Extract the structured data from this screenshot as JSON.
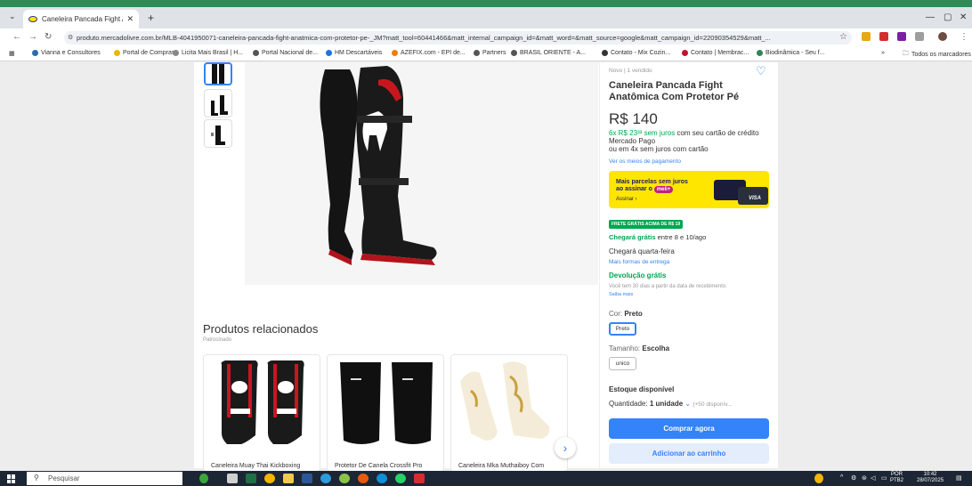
{
  "browser": {
    "tab_title": "Caneleira Pancada Fight Anatô",
    "tab_close": "✕",
    "new_tab": "+",
    "url": "produto.mercadolivre.com.br/MLB-4041950071-caneleira-pancada-fight-anatmica-com-protetor-pe-_JM?matt_tool=60441466&matt_internal_campaign_id=&matt_word=&matt_source=google&matt_campaign_id=22090354529&matt_...",
    "bookmarks": [
      {
        "label": "Vianna e Consultores",
        "color": "#2b6cb0"
      },
      {
        "label": "Portal de Compras",
        "color": "#f0b400"
      },
      {
        "label": "Licita Mais Brasil | H...",
        "color": "#888888"
      },
      {
        "label": "Portal Nacional de...",
        "color": "#555555"
      },
      {
        "label": "HM Descartáveis",
        "color": "#1a73e8"
      },
      {
        "label": "AZEFIX.com - EPI de...",
        "color": "#f07c00"
      },
      {
        "label": "Partners",
        "color": "#555555"
      },
      {
        "label": "BRASIL ORIENTE - A...",
        "color": "#555555"
      },
      {
        "label": "Contato - Mix Cozin...",
        "color": "#333333"
      },
      {
        "label": "Contato | Membrac...",
        "color": "#c8102e"
      },
      {
        "label": "Biodinâmica - Seu f...",
        "color": "#2f855a"
      }
    ],
    "bookmarks_more": "»",
    "all_bookmarks": "Todos os marcadores"
  },
  "product": {
    "condition": "Novo | 1 vendido",
    "title": "Caneleira Pancada Fight Anatômica Com Protetor Pé",
    "price": "R$ 140",
    "installments_green": "6x R$ 23³³ sem juros",
    "installments_rest": " com seu cartão de crédito Mercado Pago",
    "installments_alt": "ou em 4x sem juros com cartão",
    "payment_link": "Ver os meios de pagamento",
    "meli_line1": "Mais parcelas sem juros",
    "meli_line2": "ao assinar o",
    "meli_badge": "meli+",
    "meli_cta": "Assinar ›",
    "visa": "VISA",
    "free_shipping_badge": "FRETE GRÁTIS ACIMA DE R$ 19",
    "arrives_green": "Chegará grátis",
    "arrives_rest": " entre 8 e 10/ago",
    "arrives_alt": "Chegará quarta-feira",
    "more_delivery": "Mais formas de entrega",
    "returns_title": "Devolução grátis",
    "returns_desc": "Você tem 30 dias a partir da data de recebimento.",
    "returns_link": "Saiba mais",
    "color_label": "Cor: ",
    "color_value": "Preto",
    "color_option": "Preto",
    "size_label": "Tamanho: ",
    "size_value": "Escolha",
    "size_option": "unico",
    "stock": "Estoque disponível",
    "qty_label": "Quantidade: ",
    "qty_value": "1 unidade",
    "qty_chevron": "⌄",
    "qty_available": "(+50 disponív...",
    "buy_now": "Comprar agora",
    "add_to_cart": "Adicionar ao carrinho"
  },
  "related": {
    "title": "Produtos relacionados",
    "subtitle": "Patrocinado",
    "cards": [
      {
        "title": "Caneleira Muay Thai Kickboxing"
      },
      {
        "title": "Protetor De Canela Crossfit Pro"
      },
      {
        "title": "Caneleira Mka Muthaiboy Com"
      }
    ],
    "next": "›"
  },
  "taskbar": {
    "search": "Pesquisar",
    "tray_lang": "POR",
    "tray_sublang": "PTB2",
    "time": "10:42",
    "date": "28/07/2025"
  },
  "colors": {
    "accent": "#3483fa",
    "green": "#00a650",
    "meli_yellow": "#ffe600"
  }
}
